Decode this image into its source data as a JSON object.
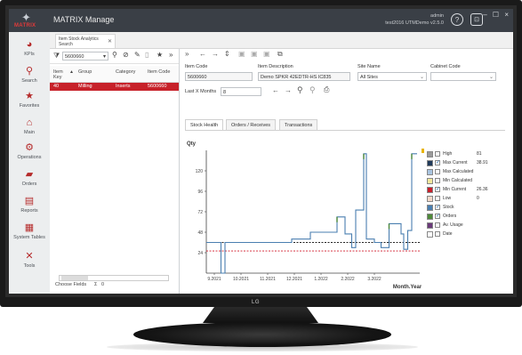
{
  "app": {
    "brand": "MATRIX",
    "title": "MATRIX Manage",
    "user_name": "admin",
    "user_detail": "test2016 UTMDemo v2.5.0",
    "help_icon": "?",
    "lock_icon": "lock",
    "window_controls": "– ☐ ×"
  },
  "sidebar": {
    "items": [
      {
        "label": "KPIs",
        "icon": "pie-chart-icon",
        "glyph": "◕"
      },
      {
        "label": "Search",
        "icon": "search-icon",
        "glyph": "⚲"
      },
      {
        "label": "Favorites",
        "icon": "star-icon",
        "glyph": "★"
      },
      {
        "label": "Main",
        "icon": "home-icon",
        "glyph": "⌂"
      },
      {
        "label": "Operations",
        "icon": "gears-icon",
        "glyph": "⚙"
      },
      {
        "label": "Orders",
        "icon": "truck-icon",
        "glyph": "▰"
      },
      {
        "label": "Reports",
        "icon": "report-icon",
        "glyph": "▤"
      },
      {
        "label": "System Tables",
        "icon": "table-icon",
        "glyph": "▦"
      },
      {
        "label": "Tools",
        "icon": "tools-icon",
        "glyph": "✕"
      }
    ]
  },
  "tabs": {
    "doc_tab_line1": "Item Stock Analytics",
    "doc_tab_line2": "Search"
  },
  "left": {
    "search_value": "5600660",
    "columns": [
      "Item Key",
      "Group",
      "Category",
      "Item Code"
    ],
    "rows": [
      {
        "key": "40",
        "group": "Milling",
        "category": "Inserts",
        "code": "5600660"
      }
    ],
    "footer_label": "Choose Fields",
    "footer_sum": "Σ",
    "footer_count": "0"
  },
  "right": {
    "labels": {
      "item_code": "Item Code",
      "item_desc": "Item Description",
      "site": "Site Name",
      "cabinet": "Cabinet Code",
      "last_months": "Last X Months"
    },
    "values": {
      "item_code": "5600660",
      "item_desc": "Demo SPKR 42EDTR-HS  IC835",
      "site": "All Sites",
      "cabinet": "",
      "last_months": "8"
    },
    "subtabs": [
      "Stock Health",
      "Orders / Receives",
      "Transactions"
    ]
  },
  "chart_data": {
    "type": "line",
    "ylabel": "Qty",
    "xlabel": "Month.Year",
    "yticks": [
      24,
      48,
      72,
      96,
      120
    ],
    "xticks": [
      "9.2021",
      "10.2021",
      "11.2021",
      "12.2021",
      "1.2022",
      "2.2022",
      "3.2022"
    ],
    "ylim": [
      0,
      144
    ],
    "series": [
      {
        "name": "Stock",
        "color": "#4a7fb0",
        "points": [
          [
            0.0,
            36
          ],
          [
            0.55,
            36
          ],
          [
            0.55,
            0
          ],
          [
            0.7,
            0
          ],
          [
            0.7,
            36
          ],
          [
            3.2,
            36
          ],
          [
            3.2,
            40
          ],
          [
            3.9,
            40
          ],
          [
            3.9,
            48
          ],
          [
            4.9,
            48
          ],
          [
            4.9,
            66
          ],
          [
            5.2,
            66
          ],
          [
            5.2,
            46
          ],
          [
            5.45,
            46
          ],
          [
            5.45,
            30
          ],
          [
            5.6,
            30
          ],
          [
            5.6,
            74
          ],
          [
            5.9,
            74
          ],
          [
            5.9,
            140
          ],
          [
            6.0,
            140
          ],
          [
            6.0,
            40
          ],
          [
            6.3,
            40
          ],
          [
            6.3,
            36
          ],
          [
            6.55,
            36
          ],
          [
            6.55,
            30
          ],
          [
            6.85,
            30
          ],
          [
            6.85,
            58
          ],
          [
            7.3,
            58
          ],
          [
            7.3,
            46
          ],
          [
            7.4,
            46
          ],
          [
            7.4,
            28
          ],
          [
            7.55,
            28
          ],
          [
            7.55,
            50
          ],
          [
            7.7,
            50
          ],
          [
            7.7,
            140
          ],
          [
            7.9,
            140
          ]
        ]
      },
      {
        "name": "Orders",
        "color": "#4f8a3a",
        "points": [
          [
            4.9,
            66
          ],
          [
            5.9,
            140
          ],
          [
            6.85,
            58
          ],
          [
            7.7,
            140
          ]
        ]
      }
    ],
    "reference_lines": [
      {
        "name": "Max Current",
        "value": 36,
        "color": "#222222",
        "style": "dashed"
      },
      {
        "name": "Min Current",
        "value": 26,
        "color": "#d0182a",
        "style": "dashed"
      }
    ],
    "legend": [
      {
        "name": "High",
        "color": "#9a9a9a",
        "checked": false,
        "value": "81"
      },
      {
        "name": "Max Current",
        "color": "#1f3a5a",
        "checked": true,
        "value": "38.91"
      },
      {
        "name": "Max Calculated",
        "color": "#a9c4df",
        "checked": false,
        "value": ""
      },
      {
        "name": "Min Calculated",
        "color": "#f2e79c",
        "checked": false,
        "value": ""
      },
      {
        "name": "Min Current",
        "color": "#c81e2a",
        "checked": true,
        "value": "26.36"
      },
      {
        "name": "Low",
        "color": "#f4d9c9",
        "checked": false,
        "value": "0"
      },
      {
        "name": "Stock",
        "color": "#4a7fb0",
        "checked": true,
        "value": ""
      },
      {
        "name": "Orders",
        "color": "#4f8a3a",
        "checked": true,
        "value": ""
      },
      {
        "name": "Av. Usage",
        "color": "#6a3a7a",
        "checked": false,
        "value": ""
      },
      {
        "name": "Date",
        "color": "#ffffff",
        "checked": false,
        "value": ""
      }
    ]
  },
  "monitor": {
    "brand": "LG"
  }
}
